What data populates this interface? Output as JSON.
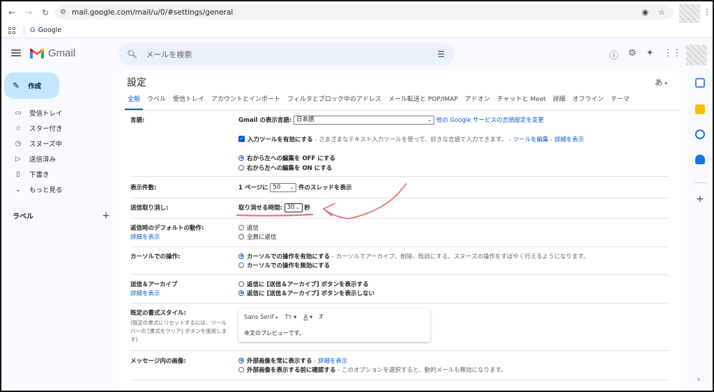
{
  "browser": {
    "url": "mail.google.com/mail/u/0/#settings/general",
    "bookmark_label": "Google"
  },
  "app": {
    "name": "Gmail",
    "search_placeholder": "メールを検索"
  },
  "sidebar": {
    "compose_label": "作成",
    "items": [
      {
        "label": "受信トレイ",
        "icon": "inbox-icon"
      },
      {
        "label": "スター付き",
        "icon": "star-icon"
      },
      {
        "label": "スヌーズ中",
        "icon": "clock-icon"
      },
      {
        "label": "送信済み",
        "icon": "send-icon"
      },
      {
        "label": "下書き",
        "icon": "draft-icon"
      },
      {
        "label": "もっと見る",
        "icon": "chevron-down-icon"
      }
    ],
    "labels_header": "ラベル"
  },
  "settings": {
    "title": "設定",
    "input_tool_glyph": "あ",
    "tabs": [
      "全般",
      "ラベル",
      "受信トレイ",
      "アカウントとインポート",
      "フィルタとブロック中のアドレス",
      "メール転送と POP/IMAP",
      "アドオン",
      "チャットと Meet",
      "詳細",
      "オフライン",
      "テーマ"
    ],
    "active_tab": "全般",
    "language": {
      "label": "言語:",
      "display_language_label": "Gmail の表示言語:",
      "display_language_value": "日本語",
      "other_services_link": "他の Google サービスの言語設定を変更",
      "input_tools_label": "入力ツールを有効にする",
      "input_tools_desc": " - さまざまなテキスト入力ツールを使って、好きな言語で入力できます。",
      "edit_tools_link": "ツールを編集",
      "details_link": "詳細を表示",
      "rtl_off": "右から左への編集を OFF にする",
      "rtl_on": "右から左への編集を ON にする"
    },
    "page_size": {
      "label": "表示件数:",
      "prefix": "1 ページに",
      "value": "50",
      "suffix": "件のスレッドを表示"
    },
    "undo_send": {
      "label": "送信取り消し:",
      "prefix": "取り消せる時間:",
      "value": "30",
      "suffix": "秒"
    },
    "reply_default": {
      "label": "返信時のデフォルトの動作:",
      "link": "詳細を表示",
      "opt1": "返信",
      "opt2": "全員に返信"
    },
    "cursor": {
      "label": "カーソルでの操作:",
      "opt1": "カーソルでの操作を有効にする",
      "opt1_desc": " - カーソルでアーカイブ、削除、既読にする、スヌーズの操作をすばやく行えるようになります。",
      "opt2": "カーソルでの操作を無効にする"
    },
    "send_archive": {
      "label": "送信＆アーカイブ",
      "link": "詳細を表示",
      "opt1": "返信に [送信＆アーカイブ] ボタンを表示する",
      "opt2": "返信に [送信＆アーカイブ] ボタンを表示しない"
    },
    "text_style": {
      "label": "既定の書式スタイル:",
      "note1": "(既定の書式にリセットするには、ツール",
      "note2": "バーの [書式をクリア] ボタンを使用しま",
      "note3": "す)",
      "font": "Sans Serif",
      "preview": "本文のプレビューです。"
    },
    "images": {
      "label": "メッセージ内の画像:",
      "opt1": "外部画像を常に表示する",
      "opt1_link": "詳細を表示",
      "opt2": "外部画像を表示する前に確認する",
      "opt2_desc": " - このオプションを選択すると、動的メールも無効になります。"
    }
  },
  "colors": {
    "accent": "#0b57d0",
    "compose_bg": "#c2e7ff",
    "annotation": "#e8737a"
  }
}
